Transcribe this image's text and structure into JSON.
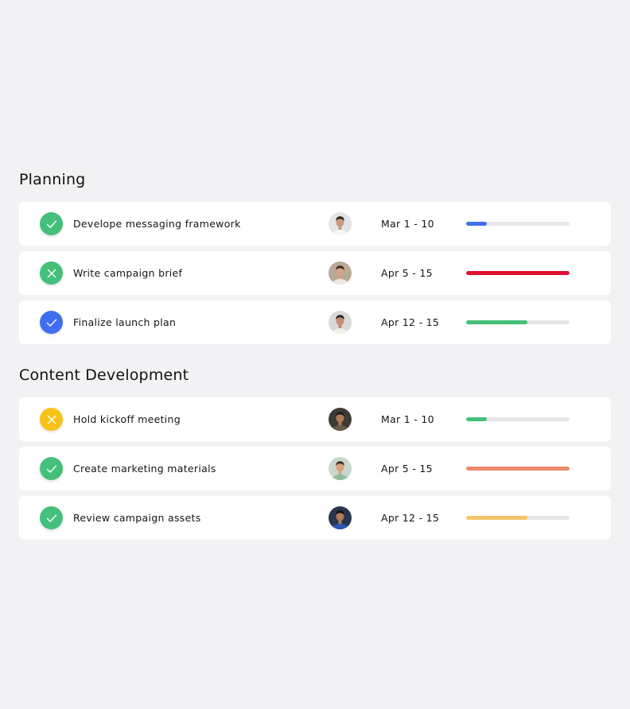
{
  "sections": [
    {
      "title": "Planning",
      "tasks": [
        {
          "name": "Develope messaging framework",
          "status": "check",
          "status_color": "#44c07a",
          "dates": "Mar 1 - 10",
          "progress": 0.2,
          "progress_color": "#3f6ef0",
          "avatar": {
            "bg": "#e4e4e4",
            "skin": "#c99a7e",
            "hair": "#2a2522",
            "shirt": "#f5f5f5"
          }
        },
        {
          "name": "Write campaign brief",
          "status": "cross",
          "status_color": "#44c07a",
          "dates": "Apr 5 - 15",
          "progress": 1.0,
          "progress_color": "#e0102e",
          "avatar": {
            "bg": "#b8aa96",
            "skin": "#d4a585",
            "hair": "#3a2a20",
            "shirt": "#efe9df"
          }
        },
        {
          "name": "Finalize launch plan",
          "status": "check",
          "status_color": "#3f6ef0",
          "dates": "Apr 12 - 15",
          "progress": 0.59,
          "progress_color": "#44c07a",
          "avatar": {
            "bg": "#d8d8d6",
            "skin": "#c48e70",
            "hair": "#2b2420",
            "shirt": "#f2efe8"
          }
        }
      ]
    },
    {
      "title": "Content Development",
      "tasks": [
        {
          "name": "Hold kickoff meeting",
          "status": "cross",
          "status_color": "#f8c318",
          "dates": "Mar 1 - 10",
          "progress": 0.2,
          "progress_color": "#44c07a",
          "avatar": {
            "bg": "#3e3a36",
            "skin": "#b07a58",
            "hair": "#1e1a18",
            "shirt": "#6a5a44"
          }
        },
        {
          "name": "Create marketing materials",
          "status": "check",
          "status_color": "#44c07a",
          "dates": "Apr 5 - 15",
          "progress": 1.0,
          "progress_color": "#ec8a6c",
          "avatar": {
            "bg": "#c9d8cc",
            "skin": "#d6a27e",
            "hair": "#4a2e22",
            "shirt": "#8fbf9a"
          }
        },
        {
          "name": "Review campaign assets",
          "status": "check",
          "status_color": "#44c07a",
          "dates": "Apr 12 - 15",
          "progress": 0.59,
          "progress_color": "#f5c46a",
          "avatar": {
            "bg": "#2a3550",
            "skin": "#b47a5a",
            "hair": "#151212",
            "shirt": "#2f56b8"
          }
        }
      ]
    }
  ]
}
